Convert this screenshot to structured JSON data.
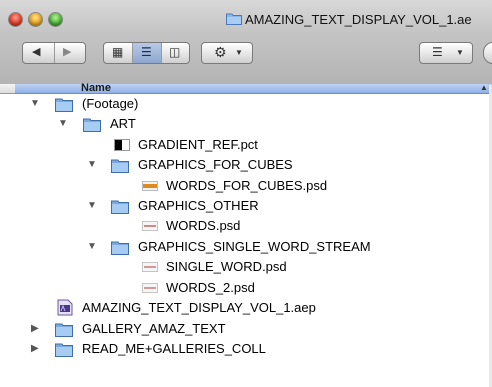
{
  "window": {
    "title": "AMAZING_TEXT_DISPLAY_VOL_1.ae"
  },
  "toolbar": {
    "back_forward": [
      "back",
      "forward"
    ],
    "view_modes": [
      "icon-view",
      "list-view",
      "column-view"
    ],
    "active_view": "list-view",
    "action_menu": "gear-menu",
    "arrange_menu": "arrange-menu"
  },
  "column": {
    "header": "Name"
  },
  "rows": [
    {
      "label": "(Footage)",
      "type": "folder",
      "expanded": true
    },
    {
      "label": "ART",
      "type": "folder",
      "expanded": true
    },
    {
      "label": "GRADIENT_REF.pct",
      "type": "pct"
    },
    {
      "label": "GRAPHICS_FOR_CUBES",
      "type": "folder",
      "expanded": true
    },
    {
      "label": "WORDS_FOR_CUBES.psd",
      "type": "psd-orange"
    },
    {
      "label": "GRAPHICS_OTHER",
      "type": "folder",
      "expanded": true
    },
    {
      "label": "WORDS.psd",
      "type": "psd"
    },
    {
      "label": "GRAPHICS_SINGLE_WORD_STREAM",
      "type": "folder",
      "expanded": true
    },
    {
      "label": "SINGLE_WORD.psd",
      "type": "psd"
    },
    {
      "label": "WORDS_2.psd",
      "type": "psd"
    },
    {
      "label": "AMAZING_TEXT_DISPLAY_VOL_1.aep",
      "type": "aep"
    },
    {
      "label": "GALLERY_AMAZ_TEXT",
      "type": "folder",
      "expanded": false
    },
    {
      "label": "READ_ME+GALLERIES_COLL",
      "type": "folder",
      "expanded": false
    }
  ]
}
